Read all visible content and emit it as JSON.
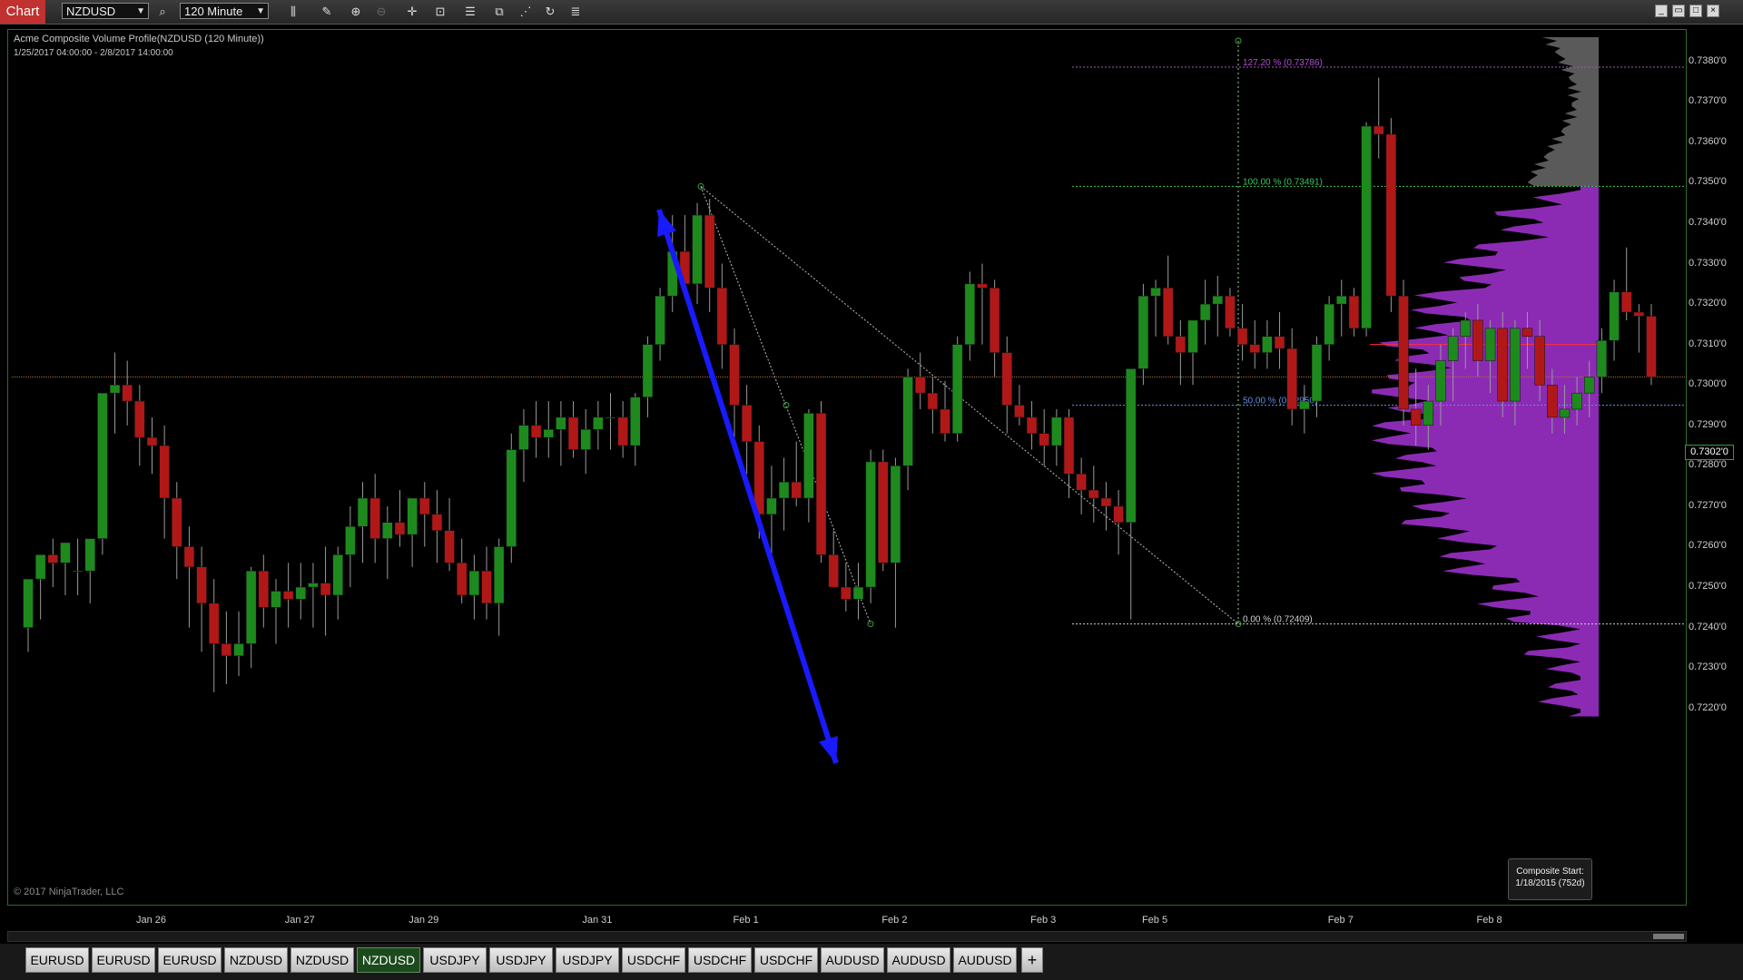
{
  "toolbar": {
    "chart_label": "Chart",
    "instrument": "NZDUSD",
    "interval": "120 Minute",
    "icons": [
      "search-icon",
      "bar-type-icon",
      "pencil-icon",
      "zoom-in-icon",
      "zoom-out-icon",
      "crosshair-icon",
      "data-box-icon",
      "properties-icon",
      "strategies-icon",
      "indicators-icon",
      "refresh-icon",
      "list-icon"
    ],
    "window_icons": [
      "minimize-icon",
      "restore-icon",
      "maximize-icon",
      "close-icon"
    ]
  },
  "chart": {
    "title": "Acme Composite Volume Profile(NZDUSD (120 Minute))",
    "range": "1/25/2017 04:00:00 - 2/8/2017 14:00:00",
    "copyright": "© 2017 NinjaTrader, LLC",
    "composite_box": [
      "Composite Start:",
      "1/18/2015 (752d)"
    ],
    "last_price": "0.7302'0",
    "colors": {
      "up": "#1e8a1e",
      "down": "#b01818",
      "profile": "#9a30c8",
      "arrow": "#1a1aff"
    }
  },
  "chart_data": {
    "type": "candlestick",
    "price_axis": [
      "0.7380'0",
      "0.7370'0",
      "0.7360'0",
      "0.7350'0",
      "0.7340'0",
      "0.7330'0",
      "0.7320'0",
      "0.7310'0",
      "0.7300'0",
      "0.7290'0",
      "0.7280'0",
      "0.7270'0",
      "0.7260'0",
      "0.7250'0",
      "0.7240'0",
      "0.7230'0",
      "0.7220'0"
    ],
    "time_axis": [
      "Jan 26",
      "Jan 27",
      "Jan 29",
      "Jan 31",
      "Feb 1",
      "Feb 2",
      "Feb 3",
      "Feb 5",
      "Feb 7",
      "Feb 8"
    ],
    "ylim": [
      0.7215,
      0.7386
    ],
    "fib_levels": [
      {
        "label": "127.20 % (0.73786)",
        "value": 0.73786
      },
      {
        "label": "100.00 % (0.73491)",
        "value": 0.73491
      },
      {
        "label": "50.00 % (0.72950)",
        "value": 0.7295
      },
      {
        "label": "0.00 % (0.72409)",
        "value": 0.72409
      }
    ],
    "candles": [
      [
        0.724,
        0.7252,
        0.7234,
        0.7252
      ],
      [
        0.7252,
        0.7258,
        0.7242,
        0.7258
      ],
      [
        0.7258,
        0.7262,
        0.725,
        0.7256
      ],
      [
        0.7256,
        0.7261,
        0.7248,
        0.7261
      ],
      [
        0.7254,
        0.7262,
        0.7248,
        0.7254
      ],
      [
        0.7254,
        0.7262,
        0.7246,
        0.7262
      ],
      [
        0.7262,
        0.7298,
        0.7258,
        0.7298
      ],
      [
        0.7298,
        0.7308,
        0.7288,
        0.73
      ],
      [
        0.73,
        0.7306,
        0.729,
        0.7296
      ],
      [
        0.7296,
        0.73,
        0.728,
        0.7287
      ],
      [
        0.7287,
        0.7292,
        0.7278,
        0.7285
      ],
      [
        0.7285,
        0.729,
        0.7262,
        0.7272
      ],
      [
        0.7272,
        0.7276,
        0.7252,
        0.726
      ],
      [
        0.726,
        0.7265,
        0.724,
        0.7255
      ],
      [
        0.7255,
        0.726,
        0.7234,
        0.7246
      ],
      [
        0.7246,
        0.7252,
        0.7224,
        0.7236
      ],
      [
        0.7236,
        0.7244,
        0.7226,
        0.7233
      ],
      [
        0.7233,
        0.7244,
        0.7228,
        0.7236
      ],
      [
        0.7236,
        0.7255,
        0.723,
        0.7254
      ],
      [
        0.7254,
        0.7258,
        0.724,
        0.7245
      ],
      [
        0.7245,
        0.7252,
        0.7236,
        0.7249
      ],
      [
        0.7249,
        0.7256,
        0.724,
        0.7247
      ],
      [
        0.7247,
        0.7256,
        0.7242,
        0.725
      ],
      [
        0.725,
        0.7256,
        0.724,
        0.7251
      ],
      [
        0.7251,
        0.726,
        0.7238,
        0.7248
      ],
      [
        0.7248,
        0.726,
        0.7242,
        0.7258
      ],
      [
        0.7258,
        0.727,
        0.725,
        0.7265
      ],
      [
        0.7265,
        0.7276,
        0.7256,
        0.7272
      ],
      [
        0.7272,
        0.7278,
        0.7256,
        0.7262
      ],
      [
        0.7262,
        0.727,
        0.7252,
        0.7266
      ],
      [
        0.7266,
        0.7274,
        0.726,
        0.7263
      ],
      [
        0.7263,
        0.7272,
        0.7255,
        0.7272
      ],
      [
        0.7272,
        0.7276,
        0.726,
        0.7268
      ],
      [
        0.7268,
        0.7274,
        0.7256,
        0.7264
      ],
      [
        0.7264,
        0.7272,
        0.7254,
        0.7256
      ],
      [
        0.7256,
        0.7262,
        0.7246,
        0.7248
      ],
      [
        0.7248,
        0.7258,
        0.7242,
        0.7254
      ],
      [
        0.7254,
        0.726,
        0.7242,
        0.7246
      ],
      [
        0.7246,
        0.7262,
        0.7238,
        0.726
      ],
      [
        0.726,
        0.7288,
        0.7256,
        0.7284
      ],
      [
        0.7284,
        0.7294,
        0.7276,
        0.729
      ],
      [
        0.729,
        0.7296,
        0.7282,
        0.7287
      ],
      [
        0.7287,
        0.7296,
        0.7282,
        0.7289
      ],
      [
        0.7289,
        0.7296,
        0.728,
        0.7292
      ],
      [
        0.7292,
        0.7296,
        0.7282,
        0.7284
      ],
      [
        0.7284,
        0.7294,
        0.7278,
        0.7289
      ],
      [
        0.7289,
        0.7296,
        0.7284,
        0.7292
      ],
      [
        0.7292,
        0.7298,
        0.7284,
        0.7292
      ],
      [
        0.7292,
        0.7296,
        0.7282,
        0.7285
      ],
      [
        0.7285,
        0.7298,
        0.728,
        0.7297
      ],
      [
        0.7297,
        0.7312,
        0.7292,
        0.731
      ],
      [
        0.731,
        0.7324,
        0.7306,
        0.7322
      ],
      [
        0.7322,
        0.7342,
        0.7318,
        0.7333
      ],
      [
        0.7333,
        0.7342,
        0.7326,
        0.7325
      ],
      [
        0.7325,
        0.7345,
        0.732,
        0.7342
      ],
      [
        0.7342,
        0.7346,
        0.7318,
        0.7324
      ],
      [
        0.7324,
        0.733,
        0.7304,
        0.731
      ],
      [
        0.731,
        0.7314,
        0.7286,
        0.7295
      ],
      [
        0.7295,
        0.73,
        0.7278,
        0.7286
      ],
      [
        0.7286,
        0.729,
        0.7262,
        0.7268
      ],
      [
        0.7268,
        0.728,
        0.7258,
        0.7272
      ],
      [
        0.7272,
        0.7282,
        0.7264,
        0.7276
      ],
      [
        0.7276,
        0.7286,
        0.727,
        0.7272
      ],
      [
        0.7272,
        0.7294,
        0.7266,
        0.7293
      ],
      [
        0.7293,
        0.7296,
        0.7256,
        0.7258
      ],
      [
        0.7258,
        0.7264,
        0.725,
        0.725
      ],
      [
        0.725,
        0.7256,
        0.7244,
        0.7247
      ],
      [
        0.7247,
        0.7256,
        0.7242,
        0.725
      ],
      [
        0.725,
        0.7284,
        0.7246,
        0.7281
      ],
      [
        0.7281,
        0.7284,
        0.7254,
        0.7256
      ],
      [
        0.7256,
        0.7282,
        0.724,
        0.728
      ],
      [
        0.728,
        0.7304,
        0.7274,
        0.7302
      ],
      [
        0.7302,
        0.7308,
        0.7294,
        0.7298
      ],
      [
        0.7298,
        0.7302,
        0.7288,
        0.7294
      ],
      [
        0.7294,
        0.7301,
        0.7286,
        0.7288
      ],
      [
        0.7288,
        0.7312,
        0.7286,
        0.731
      ],
      [
        0.731,
        0.7328,
        0.7306,
        0.7325
      ],
      [
        0.7325,
        0.733,
        0.731,
        0.7324
      ],
      [
        0.7324,
        0.7326,
        0.7302,
        0.7308
      ],
      [
        0.7308,
        0.7312,
        0.7288,
        0.7295
      ],
      [
        0.7295,
        0.73,
        0.729,
        0.7292
      ],
      [
        0.7292,
        0.7296,
        0.7284,
        0.7288
      ],
      [
        0.7288,
        0.7294,
        0.728,
        0.7285
      ],
      [
        0.7285,
        0.7294,
        0.728,
        0.7292
      ],
      [
        0.7292,
        0.7294,
        0.7272,
        0.7278
      ],
      [
        0.7278,
        0.7282,
        0.7268,
        0.7274
      ],
      [
        0.7274,
        0.728,
        0.7266,
        0.7272
      ],
      [
        0.7272,
        0.7276,
        0.7264,
        0.727
      ],
      [
        0.727,
        0.7274,
        0.7258,
        0.7266
      ],
      [
        0.7266,
        0.7302,
        0.7242,
        0.7304
      ],
      [
        0.7304,
        0.7325,
        0.73,
        0.7322
      ],
      [
        0.7322,
        0.7326,
        0.7312,
        0.7324
      ],
      [
        0.7324,
        0.7332,
        0.731,
        0.7312
      ],
      [
        0.7312,
        0.7316,
        0.73,
        0.7308
      ],
      [
        0.7308,
        0.7314,
        0.73,
        0.7316
      ],
      [
        0.7316,
        0.7326,
        0.731,
        0.732
      ],
      [
        0.732,
        0.7327,
        0.7312,
        0.7322
      ],
      [
        0.7322,
        0.7324,
        0.7312,
        0.7314
      ],
      [
        0.7314,
        0.732,
        0.7306,
        0.731
      ],
      [
        0.731,
        0.7316,
        0.7304,
        0.7308
      ],
      [
        0.7308,
        0.7316,
        0.7304,
        0.7312
      ],
      [
        0.7312,
        0.7318,
        0.7304,
        0.7309
      ],
      [
        0.7309,
        0.7314,
        0.729,
        0.7294
      ],
      [
        0.7294,
        0.73,
        0.7288,
        0.7296
      ],
      [
        0.7296,
        0.7312,
        0.7292,
        0.731
      ],
      [
        0.731,
        0.7322,
        0.7306,
        0.732
      ],
      [
        0.732,
        0.7326,
        0.7312,
        0.7322
      ],
      [
        0.7322,
        0.7324,
        0.7312,
        0.7314
      ],
      [
        0.7314,
        0.7365,
        0.7312,
        0.7364
      ],
      [
        0.7364,
        0.7376,
        0.7356,
        0.7362
      ],
      [
        0.7362,
        0.7366,
        0.7318,
        0.7322
      ],
      [
        0.7322,
        0.7326,
        0.729,
        0.7294
      ],
      [
        0.7294,
        0.7304,
        0.7285,
        0.729
      ],
      [
        0.729,
        0.73,
        0.7284,
        0.7296
      ],
      [
        0.7296,
        0.731,
        0.729,
        0.7306
      ],
      [
        0.7306,
        0.7314,
        0.7296,
        0.7312
      ],
      [
        0.7312,
        0.7318,
        0.7304,
        0.7316
      ],
      [
        0.7316,
        0.732,
        0.7302,
        0.7306
      ],
      [
        0.7306,
        0.7316,
        0.7298,
        0.7314
      ],
      [
        0.7314,
        0.7318,
        0.7292,
        0.7296
      ],
      [
        0.7296,
        0.7316,
        0.729,
        0.7314
      ],
      [
        0.7314,
        0.7318,
        0.7304,
        0.7312
      ],
      [
        0.7312,
        0.7316,
        0.7296,
        0.73
      ],
      [
        0.73,
        0.7304,
        0.7288,
        0.7292
      ],
      [
        0.7292,
        0.73,
        0.7288,
        0.7294
      ],
      [
        0.7294,
        0.7302,
        0.729,
        0.7298
      ],
      [
        0.7298,
        0.7306,
        0.7292,
        0.7302
      ],
      [
        0.7302,
        0.7314,
        0.7298,
        0.7311
      ],
      [
        0.7311,
        0.7326,
        0.7306,
        0.7323
      ],
      [
        0.7323,
        0.7334,
        0.7316,
        0.7318
      ],
      [
        0.7318,
        0.732,
        0.7308,
        0.7317
      ],
      [
        0.7317,
        0.732,
        0.73,
        0.7302
      ]
    ]
  },
  "tabs": [
    {
      "label": "EURUSD",
      "active": false
    },
    {
      "label": "EURUSD",
      "active": false
    },
    {
      "label": "EURUSD",
      "active": false
    },
    {
      "label": "NZDUSD",
      "active": false
    },
    {
      "label": "NZDUSD",
      "active": false
    },
    {
      "label": "NZDUSD",
      "active": true
    },
    {
      "label": "USDJPY",
      "active": false
    },
    {
      "label": "USDJPY",
      "active": false
    },
    {
      "label": "USDJPY",
      "active": false
    },
    {
      "label": "USDCHF",
      "active": false
    },
    {
      "label": "USDCHF",
      "active": false
    },
    {
      "label": "USDCHF",
      "active": false
    },
    {
      "label": "AUDUSD",
      "active": false
    },
    {
      "label": "AUDUSD",
      "active": false
    },
    {
      "label": "AUDUSD",
      "active": false
    }
  ],
  "add_tab_label": "+"
}
